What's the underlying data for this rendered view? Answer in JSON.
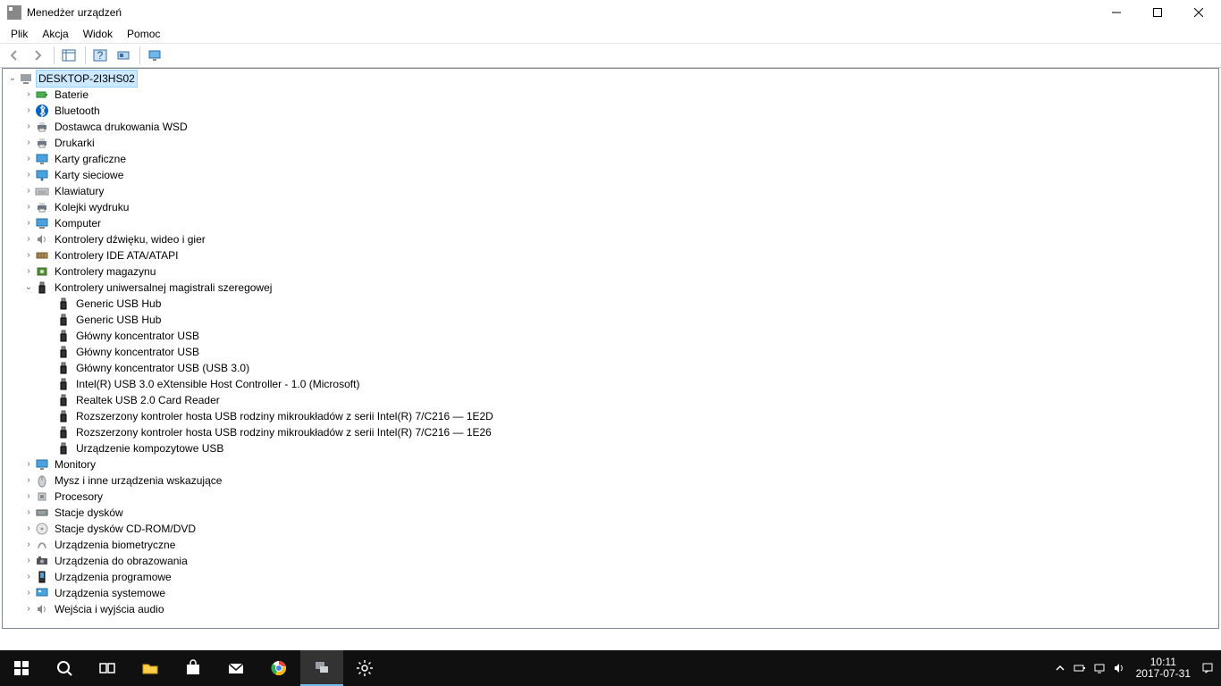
{
  "window": {
    "title": "Menedżer urządzeń"
  },
  "menu": {
    "items": [
      "Plik",
      "Akcja",
      "Widok",
      "Pomoc"
    ]
  },
  "tree": {
    "root": {
      "label": "DESKTOP-2I3HS02",
      "expanded": true,
      "selected": true
    },
    "categories": [
      {
        "label": "Baterie",
        "icon": "battery",
        "expanded": false
      },
      {
        "label": "Bluetooth",
        "icon": "bluetooth",
        "expanded": false
      },
      {
        "label": "Dostawca drukowania WSD",
        "icon": "printer",
        "expanded": false
      },
      {
        "label": "Drukarki",
        "icon": "printer",
        "expanded": false
      },
      {
        "label": "Karty graficzne",
        "icon": "display",
        "expanded": false
      },
      {
        "label": "Karty sieciowe",
        "icon": "network",
        "expanded": false
      },
      {
        "label": "Klawiatury",
        "icon": "keyboard",
        "expanded": false
      },
      {
        "label": "Kolejki wydruku",
        "icon": "printer",
        "expanded": false
      },
      {
        "label": "Komputer",
        "icon": "computer",
        "expanded": false
      },
      {
        "label": "Kontrolery dźwięku, wideo i gier",
        "icon": "sound",
        "expanded": false
      },
      {
        "label": "Kontrolery IDE ATA/ATAPI",
        "icon": "ide",
        "expanded": false
      },
      {
        "label": "Kontrolery magazynu",
        "icon": "storage",
        "expanded": false
      },
      {
        "label": "Kontrolery uniwersalnej magistrali szeregowej",
        "icon": "usb",
        "expanded": true,
        "children": [
          {
            "label": "Generic USB Hub",
            "icon": "usb"
          },
          {
            "label": "Generic USB Hub",
            "icon": "usb"
          },
          {
            "label": "Główny koncentrator USB",
            "icon": "usb"
          },
          {
            "label": "Główny koncentrator USB",
            "icon": "usb"
          },
          {
            "label": "Główny koncentrator USB (USB 3.0)",
            "icon": "usb"
          },
          {
            "label": "Intel(R) USB 3.0 eXtensible Host Controller - 1.0 (Microsoft)",
            "icon": "usb"
          },
          {
            "label": "Realtek USB 2.0 Card Reader",
            "icon": "usb"
          },
          {
            "label": "Rozszerzony kontroler hosta USB rodziny mikroukładów z serii Intel(R) 7/C216 — 1E2D",
            "icon": "usb"
          },
          {
            "label": "Rozszerzony kontroler hosta USB rodziny mikroukładów z serii Intel(R) 7/C216 — 1E26",
            "icon": "usb"
          },
          {
            "label": "Urządzenie kompozytowe USB",
            "icon": "usb"
          }
        ]
      },
      {
        "label": "Monitory",
        "icon": "monitor",
        "expanded": false
      },
      {
        "label": "Mysz i inne urządzenia wskazujące",
        "icon": "mouse",
        "expanded": false
      },
      {
        "label": "Procesory",
        "icon": "cpu",
        "expanded": false
      },
      {
        "label": "Stacje dysków",
        "icon": "disk",
        "expanded": false
      },
      {
        "label": "Stacje dysków CD-ROM/DVD",
        "icon": "cdrom",
        "expanded": false
      },
      {
        "label": "Urządzenia biometryczne",
        "icon": "biometric",
        "expanded": false
      },
      {
        "label": "Urządzenia do obrazowania",
        "icon": "imaging",
        "expanded": false
      },
      {
        "label": "Urządzenia programowe",
        "icon": "software",
        "expanded": false
      },
      {
        "label": "Urządzenia systemowe",
        "icon": "system",
        "expanded": false
      },
      {
        "label": "Wejścia i wyjścia audio",
        "icon": "audio",
        "expanded": false
      }
    ]
  },
  "taskbar": {
    "time": "10:11",
    "date": "2017-07-31"
  }
}
